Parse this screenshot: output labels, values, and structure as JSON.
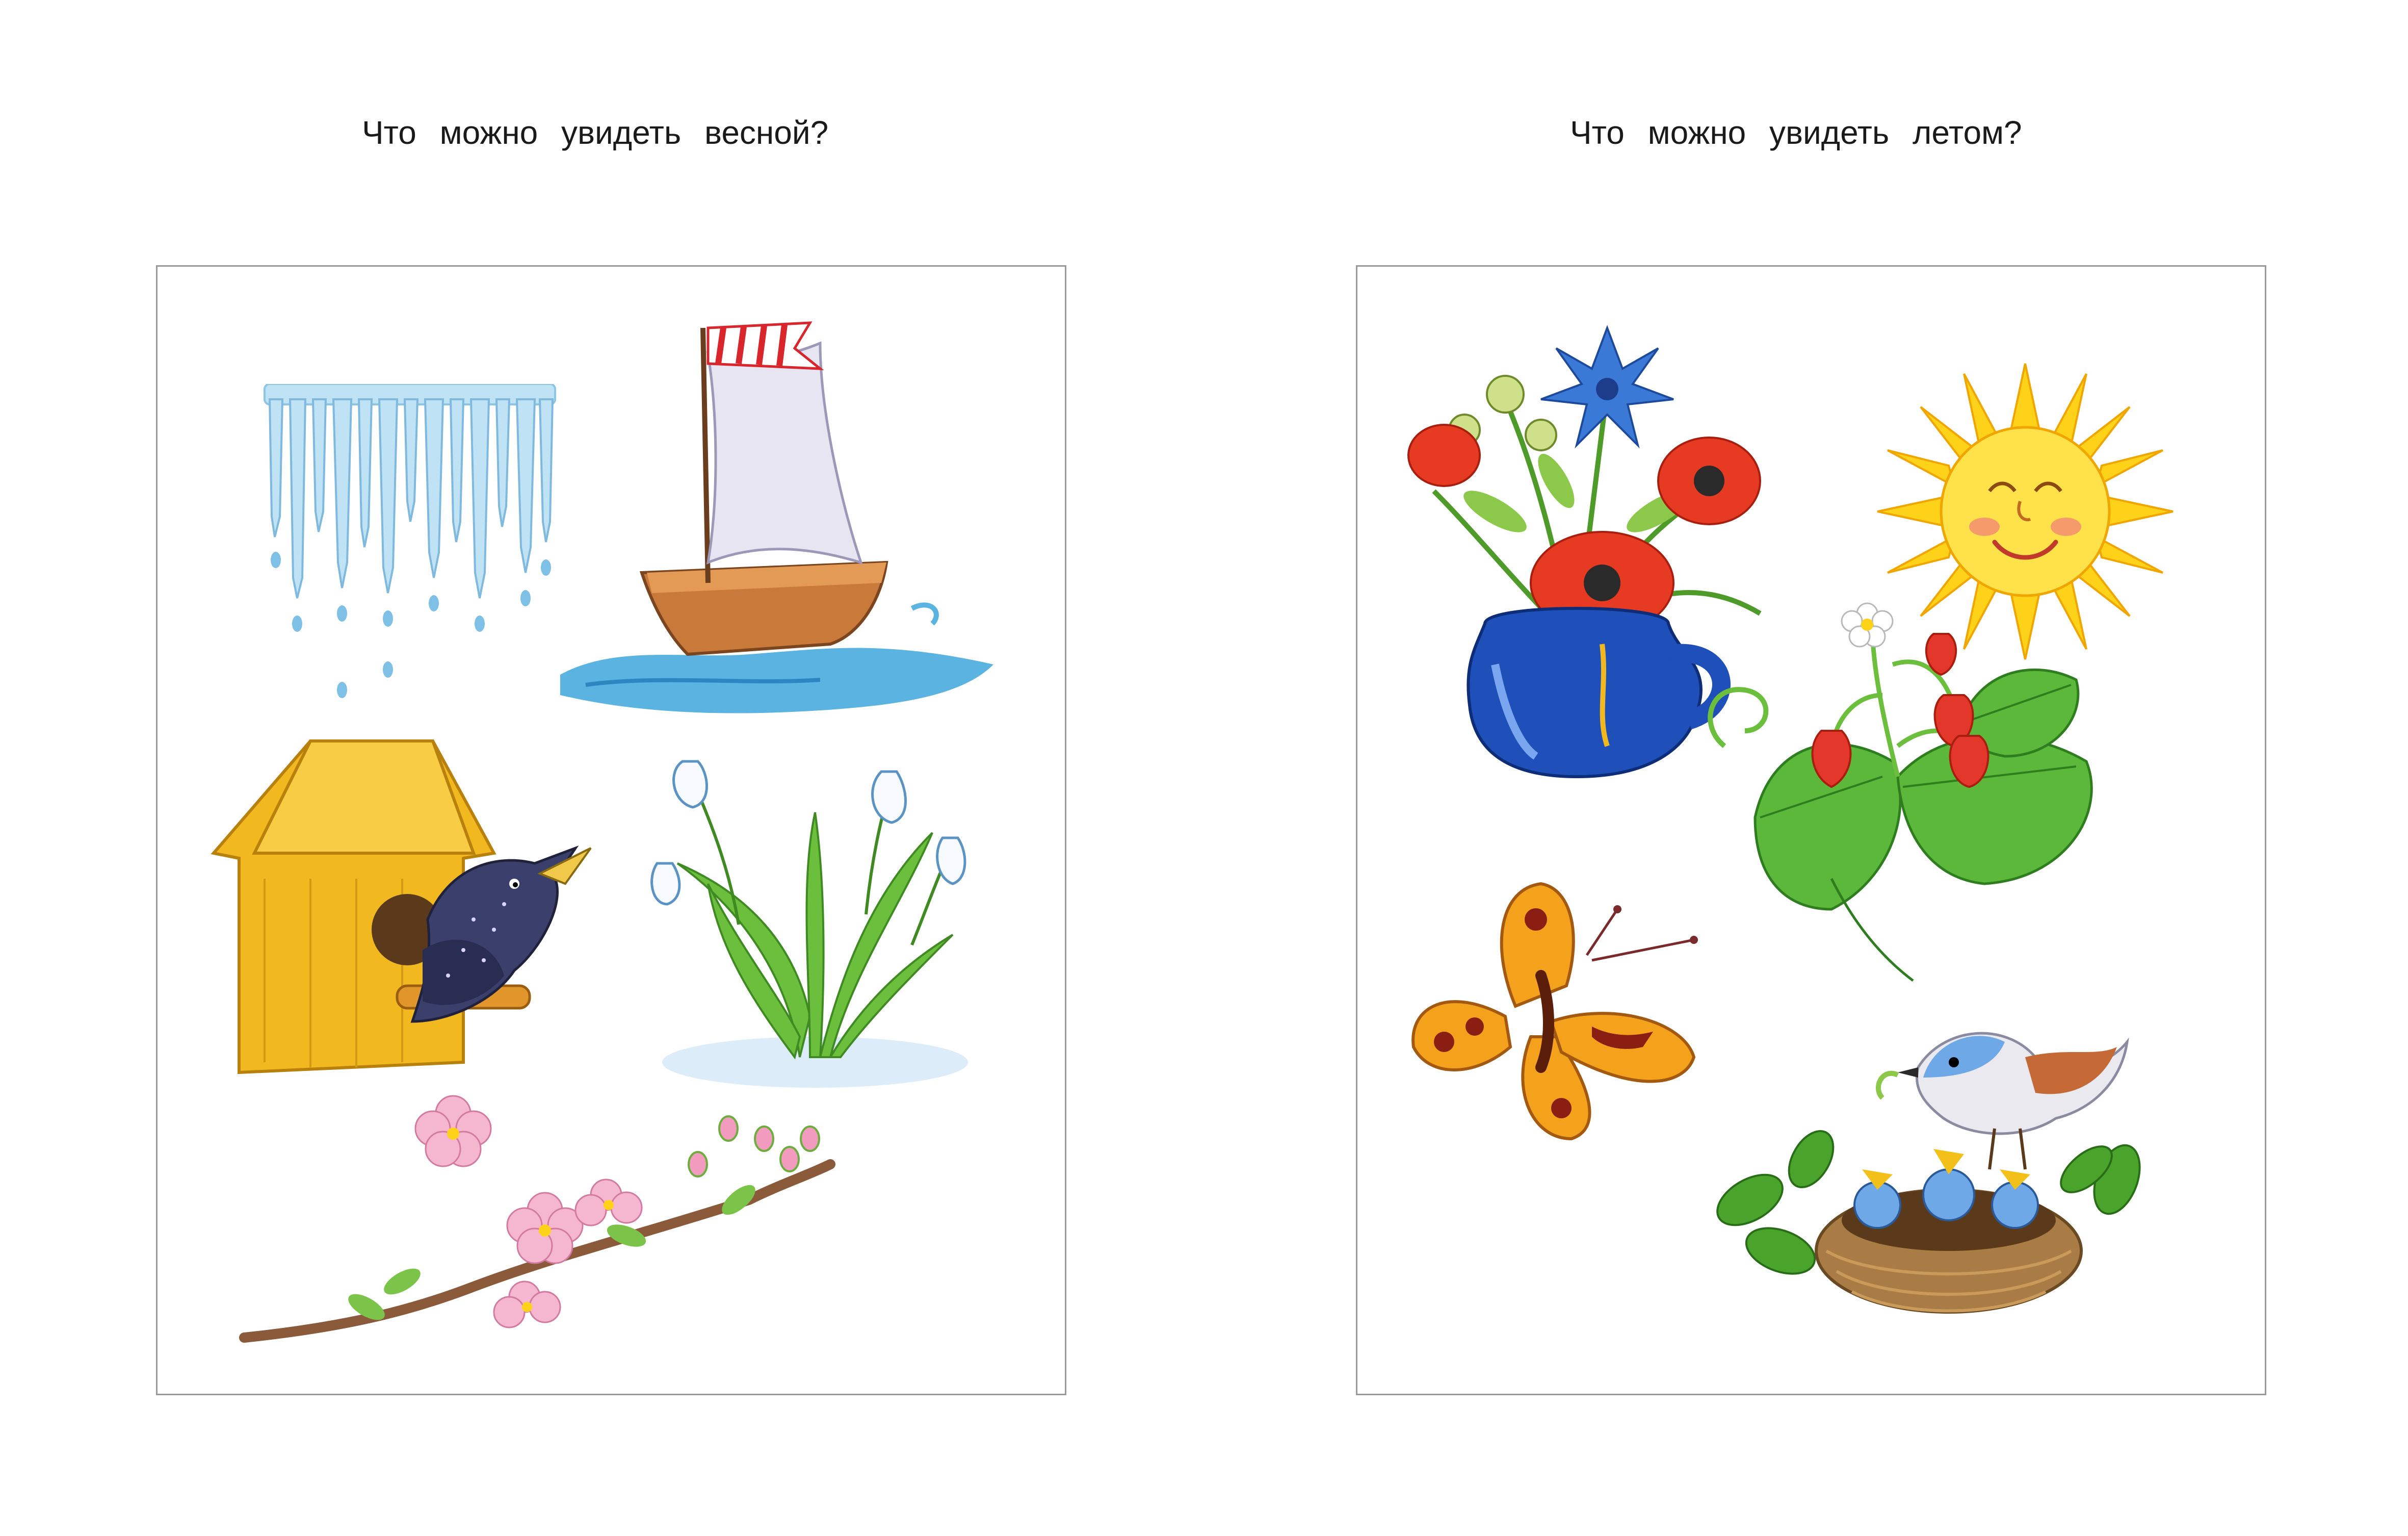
{
  "left_page": {
    "heading": "Что можно увидеть весной?",
    "illustrations": [
      {
        "name": "icicles",
        "icon": "icicles-icon"
      },
      {
        "name": "sailboat-on-water",
        "icon": "sailboat-icon"
      },
      {
        "name": "birdhouse-with-starling",
        "icon": "birdhouse-icon"
      },
      {
        "name": "snowdrops",
        "icon": "snowdrop-icon"
      },
      {
        "name": "blossoming-branch",
        "icon": "blossom-branch-icon"
      }
    ]
  },
  "right_page": {
    "heading": "Что можно увидеть летом?",
    "illustrations": [
      {
        "name": "flowers-in-jug",
        "icon": "bouquet-jug-icon"
      },
      {
        "name": "smiling-sun",
        "icon": "sun-icon"
      },
      {
        "name": "strawberry-plant",
        "icon": "strawberry-icon"
      },
      {
        "name": "butterfly",
        "icon": "butterfly-icon"
      },
      {
        "name": "bird-with-nestlings",
        "icon": "bird-nest-icon"
      }
    ]
  },
  "colors": {
    "ice": "#9fd0ec",
    "water": "#5ab3e0",
    "wood": "#c9793a",
    "birdhouse": "#f2b81f",
    "starling": "#3b3f6b",
    "snowdrop-leaf": "#6cbf3c",
    "blossom": "#f5b6cf",
    "branch": "#8a5a3a",
    "poppy": "#e63a22",
    "jug": "#1f4fb8",
    "sun": "#ffd21a",
    "strawberry": "#e4372b",
    "leaf": "#5cb83a",
    "butterfly": "#f4a21b",
    "nest": "#a97b45"
  }
}
